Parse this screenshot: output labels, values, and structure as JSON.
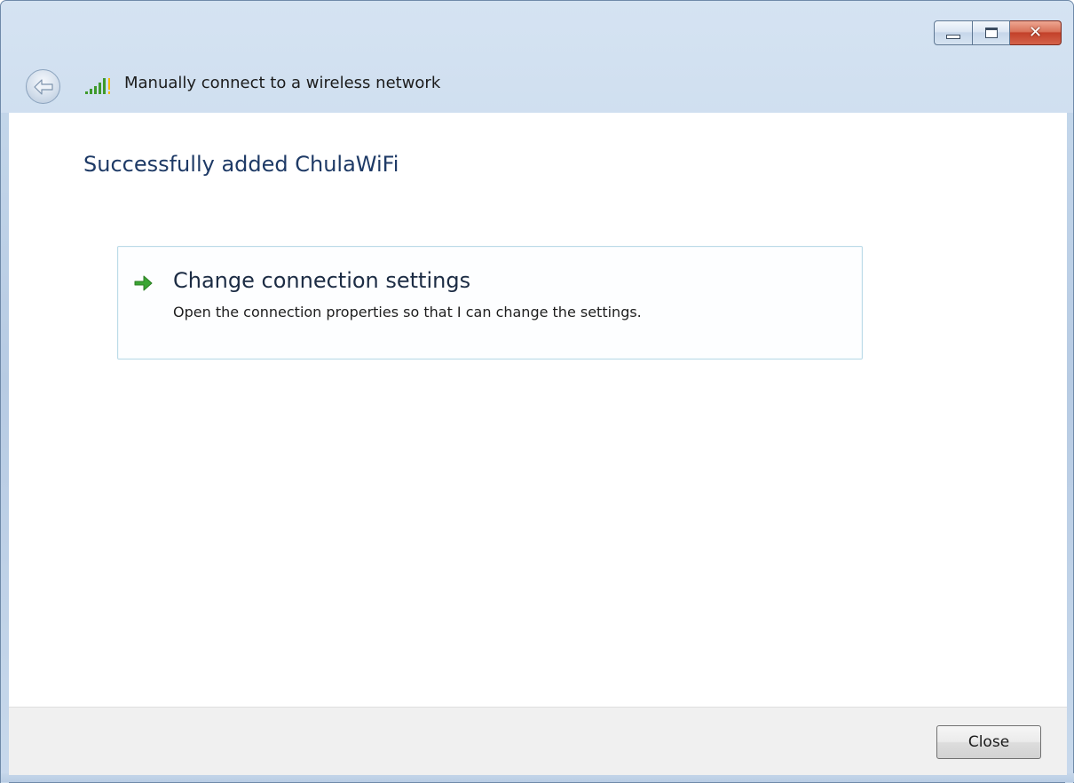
{
  "window": {
    "title": "Manually connect to a wireless network",
    "icons": {
      "back": "back-arrow-icon",
      "signal": "wireless-signal-icon",
      "minimize": "minimize-icon",
      "maximize": "maximize-icon",
      "close": "close-icon"
    },
    "close_glyph": "✕"
  },
  "content": {
    "heading": "Successfully added ChulaWiFi",
    "command_link": {
      "icon": "green-arrow-icon",
      "title": "Change connection settings",
      "description": "Open the connection properties so that I can change the settings."
    }
  },
  "footer": {
    "close_label": "Close"
  },
  "colors": {
    "heading": "#1e3a66",
    "arrow_green": "#3aa533",
    "close_button_red": "#c2412a"
  }
}
